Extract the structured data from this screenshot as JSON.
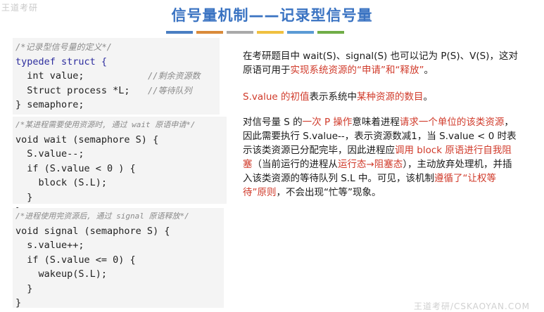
{
  "slide": {
    "title": "信号量机制——记录型信号量",
    "watermark_top_left": "王道考研",
    "footer_watermark": "王道考研/CSKAOYAN.COM"
  },
  "color_bars": [
    "#4a7ec2",
    "#d98a3a",
    "#a9a9a9",
    "#f0c040",
    "#5b9bd5",
    "#70ad47"
  ],
  "code_block_1": {
    "comment": "/*记录型信号量的定义*/",
    "line_typedef": "typedef struct {",
    "line_value": "  int value;",
    "line_value_comment": "//剩余资源数",
    "line_process": "  Struct process *L;",
    "line_process_comment": "//等待队列",
    "line_end": "} semaphore;"
  },
  "code_block_2": {
    "comment": "/*某进程需要使用资源时, 通过 wait 原语申请*/",
    "line_sig": "void wait (semaphore S) {",
    "line_dec": "  S.value--;",
    "line_if": "  if (S.value < 0 ) {",
    "line_block": "    block (S.L);",
    "line_close_if": "  }",
    "line_close": "}"
  },
  "code_block_3": {
    "comment": "/*进程使用完资源后, 通过 signal 原语释放*/",
    "line_sig": "void signal (semaphore S) {",
    "line_inc": "  s.value++;",
    "line_if": "  if (S.value <= 0) {",
    "line_wakeup": "    wakeup(S.L);",
    "line_close_if": "  }",
    "line_close": "}"
  },
  "text": {
    "p1_a": "在考研题目中 wait(S)、signal(S) 也可以记为 P(S)、V(S)，这对原语可用于",
    "p1_red": "实现系统资源的“申请”和“释放”",
    "p1_b": "。",
    "p2_a": "S.value 的初值",
    "p2_b": "表示系统中",
    "p2_red": "某种资源的数目",
    "p2_c": "。",
    "p3_a": "对信号量 S 的",
    "p3_red1": "一次 P 操作",
    "p3_b": "意味着进程",
    "p3_red2": "请求一个单位的该类资源",
    "p3_c": "，因此需要执行 S.value--，表示资源数减1，当 S.value < 0 时表示该类资源已分配完毕，因此进程应",
    "p3_red3": "调用 block 原语进行自我阻塞",
    "p3_d": "（当前运行的进程从",
    "p3_red4": "运行态→阻塞态",
    "p3_e": "），主动放弃处理机，并插入该类资源的等待队列 S.L 中。可见，该机制",
    "p3_red5": "遵循了“让权等待”原则",
    "p3_f": "，不会出现“忙等”现象。"
  }
}
